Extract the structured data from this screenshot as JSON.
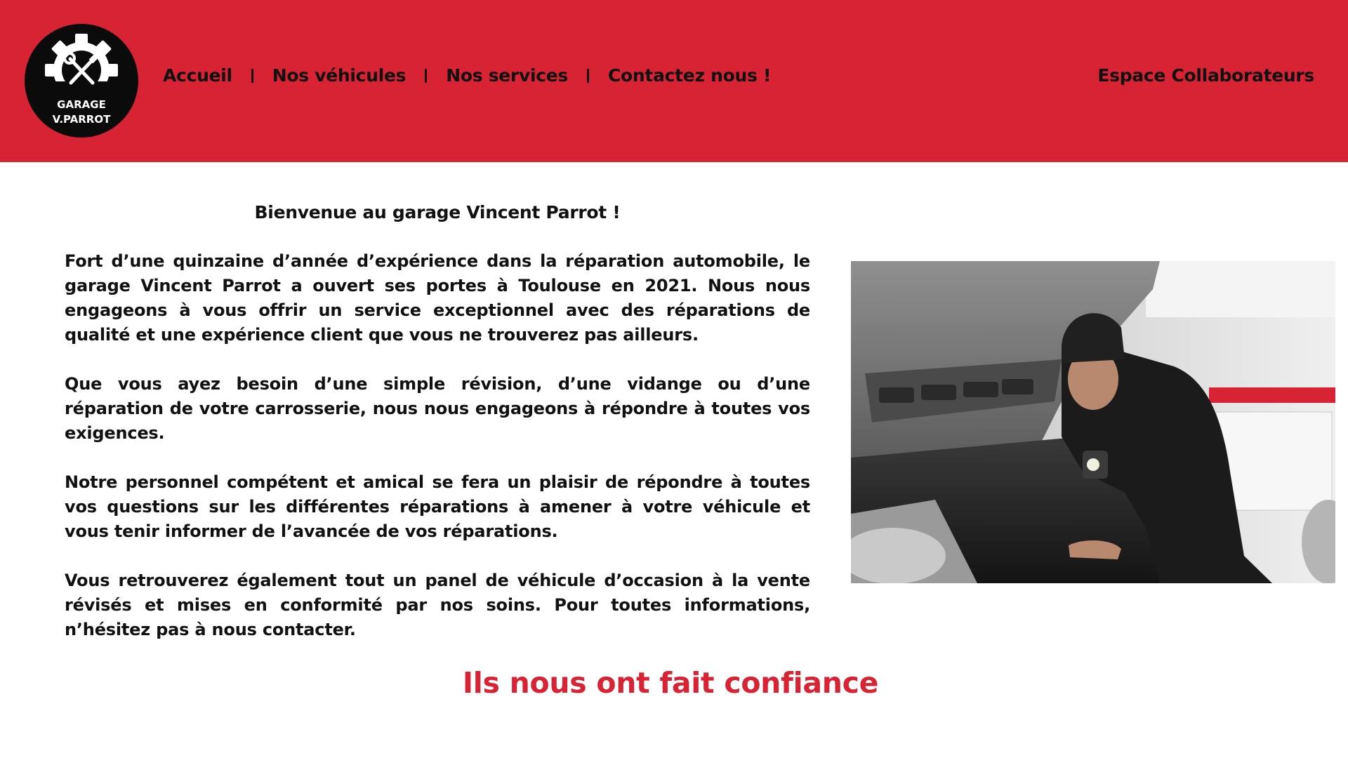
{
  "brand": {
    "logo_line1": "GARAGE",
    "logo_line2": "V.PARROT",
    "logo_icon": "gear-wrench-screwdriver-icon",
    "primary_color": "#d82335",
    "logo_background": "#0b0b0b"
  },
  "nav": {
    "items": [
      {
        "label": "Accueil"
      },
      {
        "label": "Nos véhicules"
      },
      {
        "label": "Nos services"
      },
      {
        "label": "Contactez nous !"
      }
    ],
    "separator": "I",
    "staff_link": "Espace Collaborateurs"
  },
  "main": {
    "welcome_title": "Bienvenue au garage Vincent Parrot !",
    "paragraphs": [
      "Fort d’une quinzaine d’année d’expérience dans la réparation automobile, le garage Vincent Parrot a ouvert ses portes à Toulouse en 2021. Nous nous engageons à vous offrir un service exceptionnel avec des réparations de qualité et une expérience client que vous ne trouverez pas ailleurs.",
      "Que vous ayez besoin d’une simple révision, d’une vidange ou d’une réparation de votre carrosserie, nous nous engageons à répondre à toutes vos exigences.",
      "Notre personnel compétent et amical se fera un plaisir de répondre à toutes vos questions sur les différentes réparations à amener à votre véhicule et vous tenir informer de l’avancée de vos réparations.",
      "Vous retrouverez également tout un panel de véhicule d’occasion à la vente révisés et mises en conformité par nos soins. Pour toutes informations, n’hésitez pas à nous contacter."
    ],
    "photo_subject": "mechanic-under-car-hood-photo"
  },
  "testimonials": {
    "title": "Ils nous ont fait confiance"
  }
}
